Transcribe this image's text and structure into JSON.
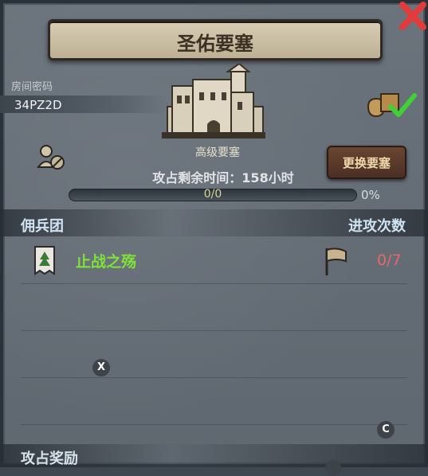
{
  "title": "圣佑要塞",
  "room": {
    "label": "房间密码",
    "code": "34PZ2D"
  },
  "fortress": {
    "name": "高级要塞",
    "attack_time": "攻占剩余时间：158小时"
  },
  "actions": {
    "change_button": "更换要塞"
  },
  "progress": {
    "text": "0/0",
    "percent": "0%"
  },
  "mercenary": {
    "header_left": "佣兵团",
    "header_right": "进攻次数",
    "rows": [
      {
        "name": "止战之殇",
        "count": "0/7"
      }
    ]
  },
  "markers": {
    "x": "X",
    "c": "C"
  },
  "rewards": {
    "title": "攻占奖励"
  },
  "colors": {
    "green": "#7fe23a",
    "red": "#e36a6a",
    "accent": "#f0d9a9"
  }
}
